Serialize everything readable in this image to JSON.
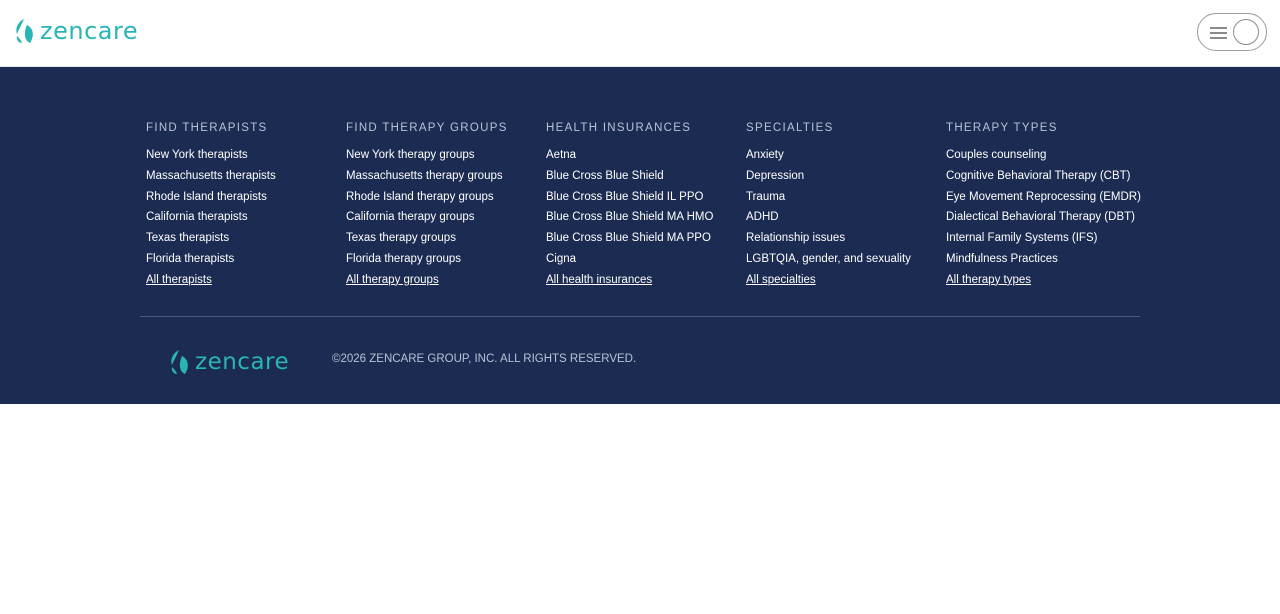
{
  "header": {
    "logo_text": "zencare"
  },
  "footer": {
    "columns": [
      {
        "heading": "FIND THERAPISTS",
        "links": [
          "New York therapists",
          "Massachusetts therapists",
          "Rhode Island therapists",
          "California therapists",
          "Texas therapists",
          "Florida therapists"
        ],
        "all_link": "All therapists"
      },
      {
        "heading": "FIND THERAPY GROUPS",
        "links": [
          "New York therapy groups",
          "Massachusetts therapy groups",
          "Rhode Island therapy groups",
          "California therapy groups",
          "Texas therapy groups",
          "Florida therapy groups"
        ],
        "all_link": "All therapy groups"
      },
      {
        "heading": "HEALTH INSURANCES",
        "links": [
          "Aetna",
          "Blue Cross Blue Shield",
          "Blue Cross Blue Shield IL PPO",
          "Blue Cross Blue Shield MA HMO",
          "Blue Cross Blue Shield MA PPO",
          "Cigna"
        ],
        "all_link": "All health insurances"
      },
      {
        "heading": "SPECIALTIES",
        "links": [
          "Anxiety",
          "Depression",
          "Trauma",
          "ADHD",
          "Relationship issues",
          "LGBTQIA, gender, and sexuality"
        ],
        "all_link": "All specialties"
      },
      {
        "heading": "THERAPY TYPES",
        "links": [
          "Couples counseling",
          "Cognitive Behavioral Therapy (CBT)",
          "Eye Movement Reprocessing (EMDR)",
          "Dialectical Behavioral Therapy (DBT)",
          "Internal Family Systems (IFS)",
          "Mindfulness Practices"
        ],
        "all_link": "All therapy types"
      }
    ],
    "logo_text": "zencare",
    "copyright": "©2026 ZENCARE GROUP, INC. ALL RIGHTS RESERVED."
  },
  "colors": {
    "brand": "#2ab5b5",
    "footer_bg": "#1c2b52"
  },
  "icons": {
    "logo_mark": "zencare-leaf-icon",
    "menu": "hamburger-menu-icon",
    "account": "account-circle-icon"
  }
}
